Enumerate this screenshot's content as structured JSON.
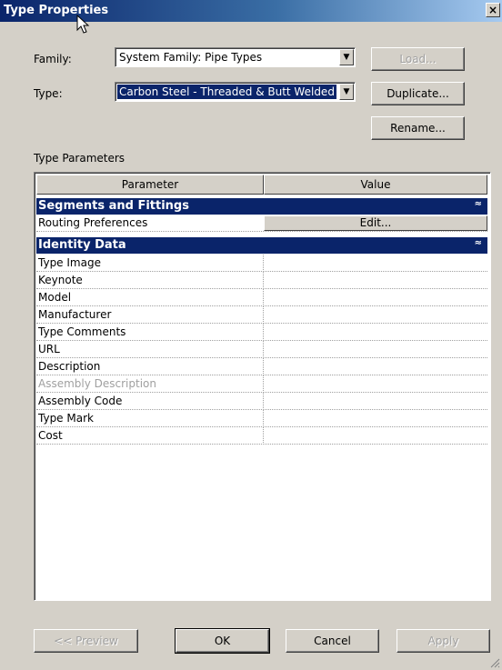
{
  "window": {
    "title": "Type Properties",
    "close_symbol": "×"
  },
  "family": {
    "label": "Family:",
    "value": "System Family: Pipe Types"
  },
  "type": {
    "label": "Type:",
    "value": "Carbon Steel - Threaded & Butt Welded"
  },
  "buttons": {
    "load": "Load...",
    "duplicate": "Duplicate...",
    "rename": "Rename...",
    "preview": "<< Preview",
    "ok": "OK",
    "cancel": "Cancel",
    "apply": "Apply"
  },
  "type_parameters": {
    "label": "Type Parameters",
    "columns": [
      "Parameter",
      "Value"
    ],
    "groups": [
      {
        "name": "Segments and Fittings",
        "collapse_symbol": "≈",
        "rows": [
          {
            "name": "Routing Preferences",
            "value": "Edit..."
          }
        ]
      },
      {
        "name": "Identity Data",
        "collapse_symbol": "≈",
        "rows": [
          {
            "name": "Type Image",
            "value": ""
          },
          {
            "name": "Keynote",
            "value": ""
          },
          {
            "name": "Model",
            "value": ""
          },
          {
            "name": "Manufacturer",
            "value": ""
          },
          {
            "name": "Type Comments",
            "value": ""
          },
          {
            "name": "URL",
            "value": ""
          },
          {
            "name": "Description",
            "value": ""
          },
          {
            "name": "Assembly Description",
            "value": "",
            "disabled": true
          },
          {
            "name": "Assembly Code",
            "value": ""
          },
          {
            "name": "Type Mark",
            "value": ""
          },
          {
            "name": "Cost",
            "value": ""
          }
        ]
      }
    ]
  },
  "colors": {
    "titlebar": "#0a246a",
    "group_header": "#0a246a",
    "dialog_bg": "#d4d0c8"
  }
}
